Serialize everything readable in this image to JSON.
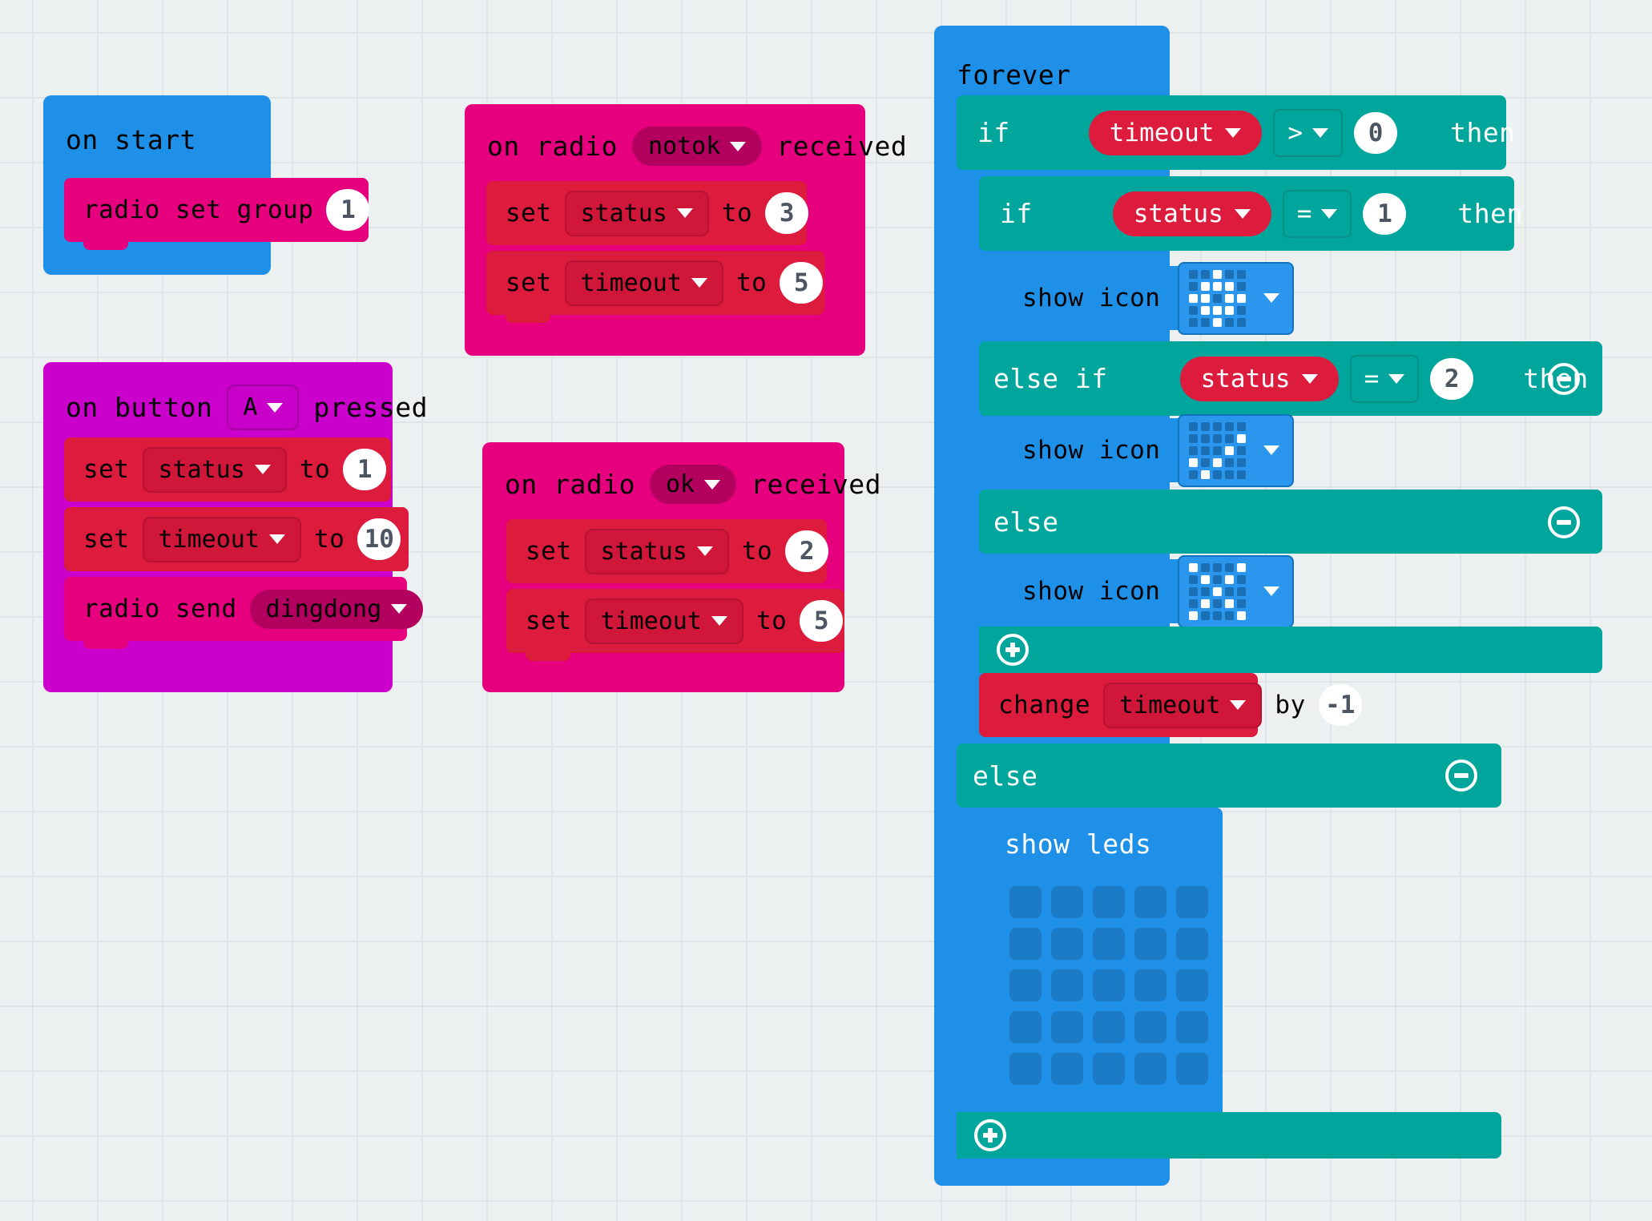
{
  "editor": {
    "name": "makecode-blocks-workspace",
    "background": "#ecf0f1",
    "grid_color": "#dfe4e6"
  },
  "colors": {
    "basic": "#1e90e8",
    "radio": "#e6007e",
    "variables": "#dd1b3c",
    "input": "#cc00cc",
    "logic": "#00a59b",
    "value_text": "#4c5561"
  },
  "stacks": {
    "on_start": {
      "hat_label": "on start",
      "children": [
        {
          "kind": "radio-set-group",
          "label": "radio set group",
          "value": "1"
        }
      ]
    },
    "on_button_pressed": {
      "prefix": "on button",
      "button": "A",
      "suffix": "pressed",
      "children": [
        {
          "kind": "set-var",
          "label": "set",
          "variable": "status",
          "to": "to",
          "value": "1"
        },
        {
          "kind": "set-var",
          "label": "set",
          "variable": "timeout",
          "to": "to",
          "value": "10"
        },
        {
          "kind": "radio-send",
          "label": "radio send",
          "message": "dingdong"
        }
      ]
    },
    "on_radio_notok": {
      "prefix": "on radio",
      "message": "notok",
      "suffix": "received",
      "children": [
        {
          "kind": "set-var",
          "label": "set",
          "variable": "status",
          "to": "to",
          "value": "3"
        },
        {
          "kind": "set-var",
          "label": "set",
          "variable": "timeout",
          "to": "to",
          "value": "5"
        }
      ]
    },
    "on_radio_ok": {
      "prefix": "on radio",
      "message": "ok",
      "suffix": "received",
      "children": [
        {
          "kind": "set-var",
          "label": "set",
          "variable": "status",
          "to": "to",
          "value": "2"
        },
        {
          "kind": "set-var",
          "label": "set",
          "variable": "timeout",
          "to": "to",
          "value": "5"
        }
      ]
    },
    "forever": {
      "hat_label": "forever",
      "if_outer": {
        "if_label": "if",
        "variable": "timeout",
        "operator": ">",
        "operand": "0",
        "then_label": "then",
        "else_label": "else"
      },
      "if_inner": {
        "if_label": "if",
        "variable": "status",
        "operator": "=",
        "operand": "1",
        "then_label": "then",
        "elseif_label": "else if",
        "elseif_variable": "status",
        "elseif_operator": "=",
        "elseif_operand": "2",
        "elseif_then_label": "then",
        "else_label": "else"
      },
      "show_icon_1": {
        "label": "show icon",
        "icon": "diamond-icon"
      },
      "show_icon_2": {
        "label": "show icon",
        "icon": "yes-check-icon"
      },
      "show_icon_3": {
        "label": "show icon",
        "icon": "no-cross-icon"
      },
      "change_timeout": {
        "label": "change",
        "variable": "timeout",
        "by_label": "by",
        "value": "-1"
      },
      "show_leds": {
        "label": "show leds"
      }
    }
  },
  "led_patterns": {
    "diamond-icon": [
      [
        0,
        0,
        1,
        0,
        0
      ],
      [
        0,
        1,
        1,
        1,
        0
      ],
      [
        1,
        1,
        0,
        1,
        1
      ],
      [
        0,
        1,
        1,
        1,
        0
      ],
      [
        0,
        0,
        1,
        0,
        0
      ]
    ],
    "yes-check-icon": [
      [
        0,
        0,
        0,
        0,
        0
      ],
      [
        0,
        0,
        0,
        0,
        1
      ],
      [
        0,
        0,
        0,
        1,
        0
      ],
      [
        1,
        0,
        1,
        0,
        0
      ],
      [
        0,
        1,
        0,
        0,
        0
      ]
    ],
    "no-cross-icon": [
      [
        1,
        0,
        0,
        0,
        1
      ],
      [
        0,
        1,
        0,
        1,
        0
      ],
      [
        0,
        0,
        1,
        0,
        0
      ],
      [
        0,
        1,
        0,
        1,
        0
      ],
      [
        1,
        0,
        0,
        0,
        1
      ]
    ],
    "show-leds-blank": [
      [
        0,
        0,
        0,
        0,
        0
      ],
      [
        0,
        0,
        0,
        0,
        0
      ],
      [
        0,
        0,
        0,
        0,
        0
      ],
      [
        0,
        0,
        0,
        0,
        0
      ],
      [
        0,
        0,
        0,
        0,
        0
      ]
    ]
  },
  "mutators": {
    "minus_label": "remove-option",
    "plus_label": "add-option"
  }
}
